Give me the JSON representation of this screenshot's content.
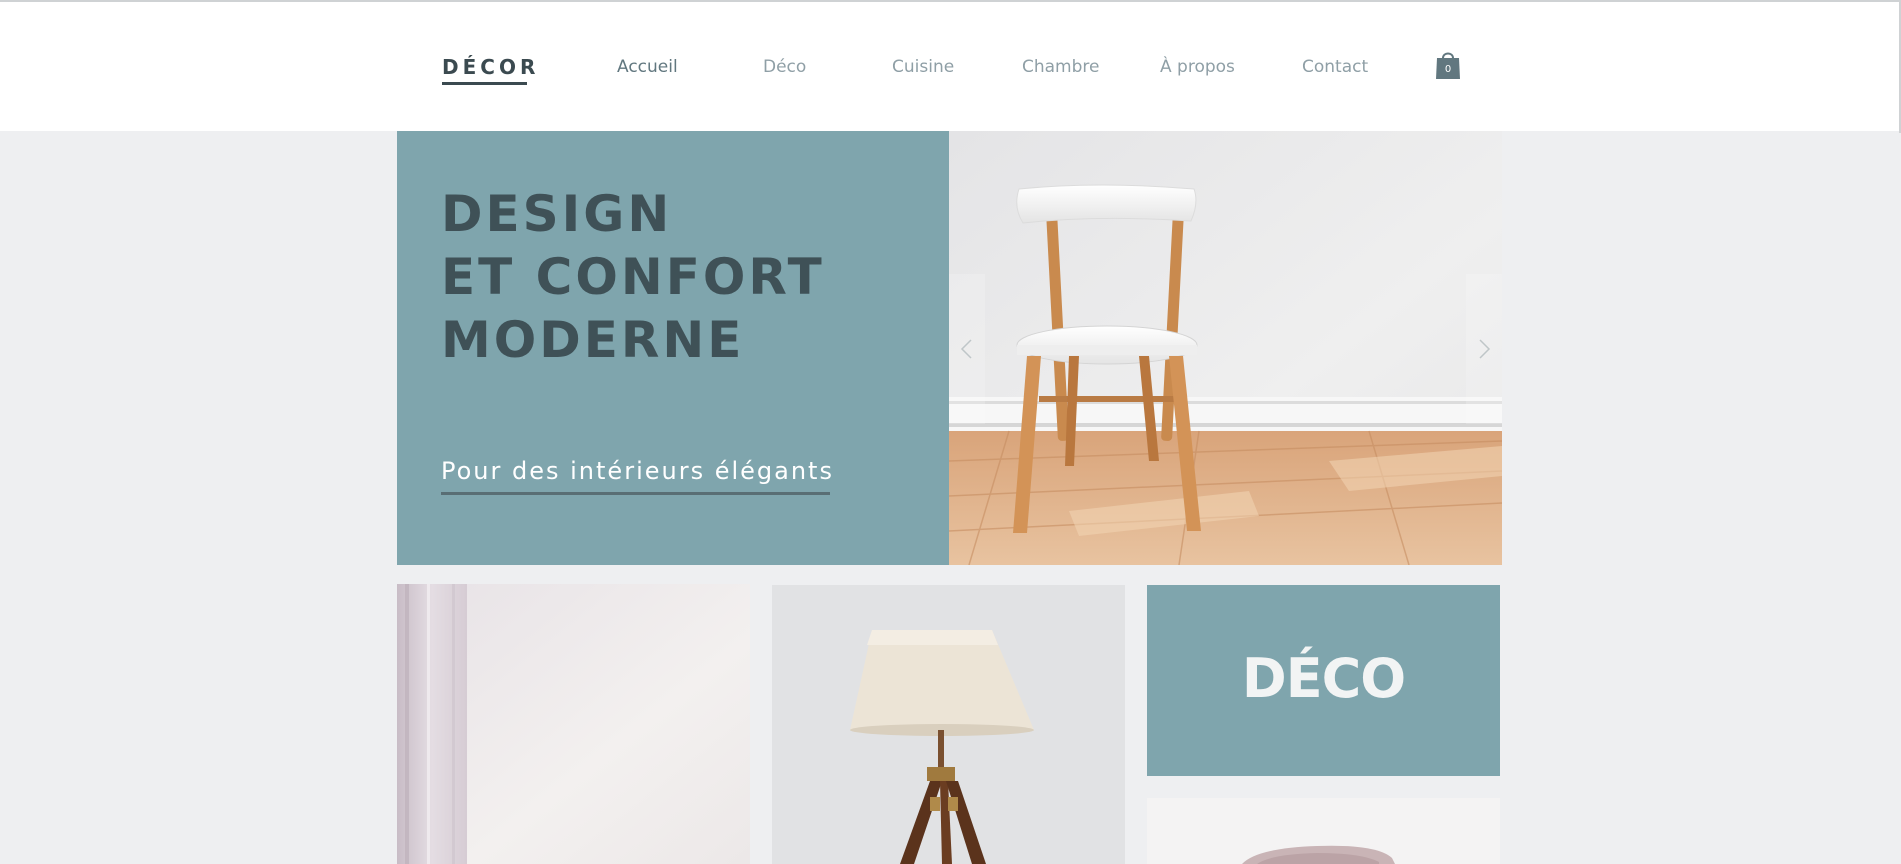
{
  "header": {
    "logo": "DÉCOR",
    "nav": [
      {
        "label": "Accueil"
      },
      {
        "label": "Déco"
      },
      {
        "label": "Cuisine"
      },
      {
        "label": "Chambre"
      },
      {
        "label": "À propos"
      },
      {
        "label": "Contact"
      }
    ],
    "cart": {
      "count": "0",
      "icon": "shopping-bag-icon"
    }
  },
  "hero": {
    "title_lines": [
      "DESIGN",
      "ET CONFORT",
      "MODERNE"
    ],
    "link": "Pour des intérieurs élégants",
    "slideshow": {
      "prev_icon": "chevron-left-icon",
      "next_icon": "chevron-right-icon"
    }
  },
  "grid": {
    "deco_label": "DÉCO"
  },
  "colors": {
    "accent": "#7fa5ad",
    "dark_text": "#3f5157",
    "background": "#eeeff1",
    "nav_text": "#8f9fa6"
  }
}
